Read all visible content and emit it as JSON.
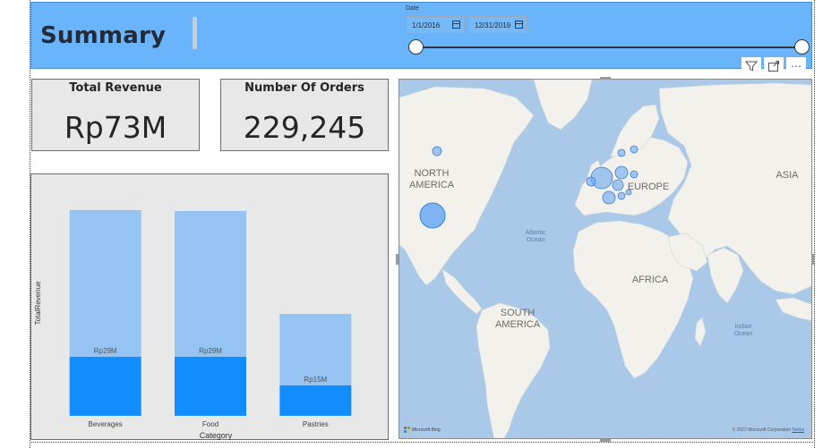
{
  "header": {
    "title": "Summary"
  },
  "date_slicer": {
    "label": "Date",
    "start_date": "1/1/2016",
    "end_date": "12/31/2019",
    "icon": "calendar-icon"
  },
  "visual_header": {
    "icons": [
      "filter-icon",
      "focus-mode-icon",
      "more-options-icon"
    ],
    "more_label": "⋯"
  },
  "kpis": {
    "total_revenue": {
      "title": "Total Revenue",
      "value": "Rp73M"
    },
    "number_of_orders": {
      "title": "Number Of Orders",
      "value": "229,245"
    }
  },
  "chart_data": {
    "type": "bar",
    "title": "",
    "xlabel": "Category",
    "ylabel": "TotalRevenue",
    "categories": [
      "Beverages",
      "Food",
      "Pastries"
    ],
    "ylim": [
      0,
      115
    ],
    "series": [
      {
        "values": [
          29,
          29,
          15
        ],
        "color": "#118dff"
      },
      {
        "values": [
          72,
          71.5,
          35
        ],
        "color": "#95c4f3"
      }
    ],
    "data_labels": [
      "Rp29M",
      "Rp29M",
      "Rp15M"
    ],
    "legend": "none",
    "grid": false
  },
  "map": {
    "labels": {
      "north_america": [
        "NORTH",
        "AMERICA"
      ],
      "south_america": [
        "SOUTH",
        "AMERICA"
      ],
      "europe": "EUROPE",
      "asia": "ASIA",
      "africa": "AFRICA",
      "atlantic": [
        "Atlantic",
        "Ocean"
      ],
      "indian": [
        "Indian",
        "Ocean"
      ]
    },
    "attribution": "© 2022 Microsoft Corporation",
    "terms": "Terms",
    "provider": "Microsoft Bing",
    "colors": {
      "water": "#aac9e8",
      "land": "#f2f1ec",
      "bubble_fill": "#6aa9f2",
      "bubble_stroke": "#3d7fd0"
    }
  }
}
